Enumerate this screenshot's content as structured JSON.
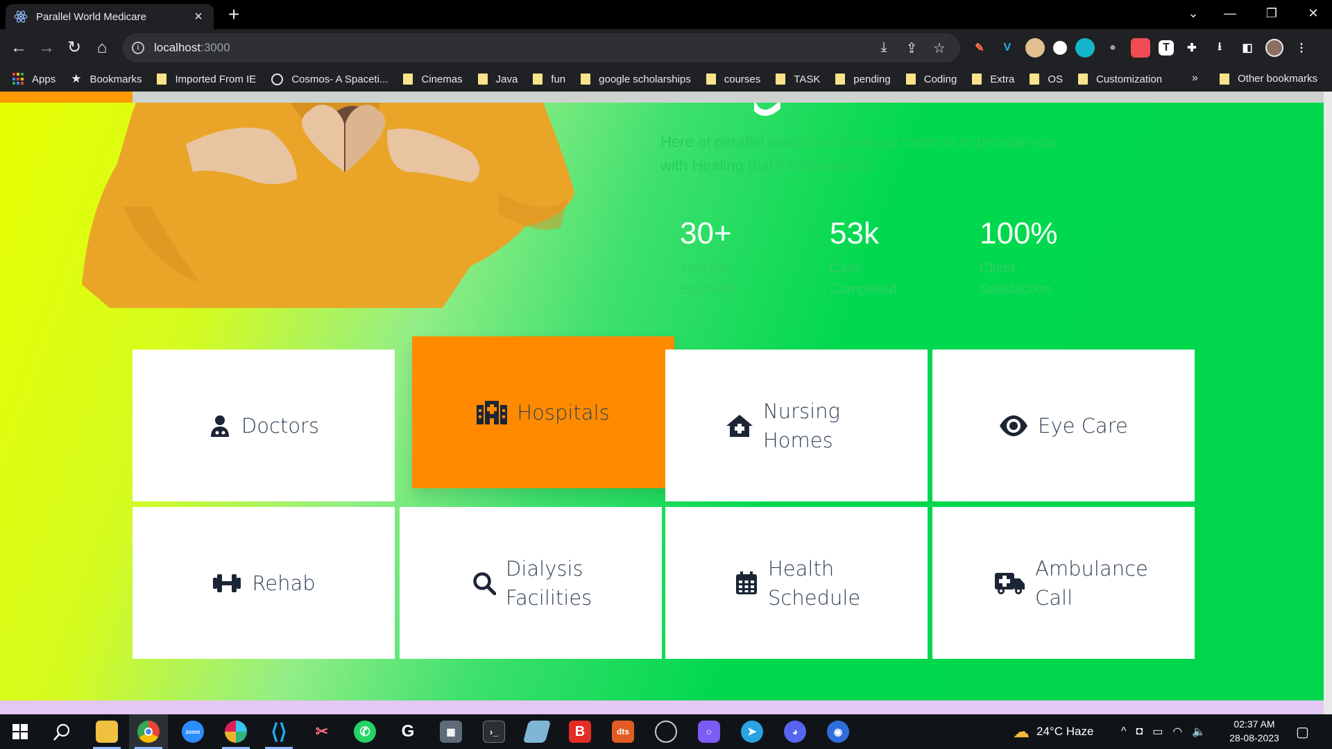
{
  "browser": {
    "tab_title": "Parallel World Medicare",
    "url_host": "localhost",
    "url_port": ":3000",
    "bookmarks": [
      {
        "label": "Apps",
        "kind": "apps"
      },
      {
        "label": "Bookmarks",
        "kind": "star"
      },
      {
        "label": "Imported From IE",
        "kind": "folder"
      },
      {
        "label": "Cosmos- A Spaceti...",
        "kind": "globe"
      },
      {
        "label": "Cinemas",
        "kind": "folder"
      },
      {
        "label": "Java",
        "kind": "folder"
      },
      {
        "label": "fun",
        "kind": "folder"
      },
      {
        "label": "google scholarships",
        "kind": "folder"
      },
      {
        "label": "courses",
        "kind": "folder"
      },
      {
        "label": "TASK",
        "kind": "folder"
      },
      {
        "label": "pending",
        "kind": "folder"
      },
      {
        "label": "Coding",
        "kind": "folder"
      },
      {
        "label": "Extra",
        "kind": "folder"
      },
      {
        "label": "OS",
        "kind": "folder"
      },
      {
        "label": "Customization",
        "kind": "folder"
      }
    ],
    "bookmarks_more": "»",
    "other_bookmarks": "Other bookmarks"
  },
  "page": {
    "scroll_progress_percent": 10,
    "hero": {
      "motto": "Here at parallel world medicare our motto is to provide you with Healing that's Otherworldly."
    },
    "stats": [
      {
        "value": "30+",
        "label": "Years of Excellent"
      },
      {
        "value": "53k",
        "label": "Case Completed"
      },
      {
        "value": "100%",
        "label": "Client Satisfaction"
      }
    ],
    "services": [
      {
        "label": "Doctors",
        "icon": "user-doctor-icon",
        "active": false
      },
      {
        "label": "Hospitals",
        "icon": "hospital-icon",
        "active": true
      },
      {
        "label": "Nursing Homes",
        "icon": "house-medical-icon",
        "active": false
      },
      {
        "label": "Eye Care",
        "icon": "eye-icon",
        "active": false
      },
      {
        "label": "Rehab",
        "icon": "dumbbell-icon",
        "active": false
      },
      {
        "label": "Dialysis Facilities",
        "icon": "magnifying-glass-icon",
        "active": false
      },
      {
        "label": "Health Schedule",
        "icon": "calendar-icon",
        "active": false
      },
      {
        "label": "Ambulance Call",
        "icon": "truck-medical-icon",
        "active": false
      }
    ],
    "colors": {
      "accent_orange": "#ff8a00",
      "card_text": "#2f4256",
      "gradient_start": "#e7ff00",
      "gradient_end": "#00d64c"
    }
  },
  "taskbar": {
    "weather": "24°C  Haze",
    "time": "02:37 AM",
    "date": "28-08-2023",
    "zoom_label": "zoom",
    "dts_label": "dts",
    "b_label": "B"
  }
}
